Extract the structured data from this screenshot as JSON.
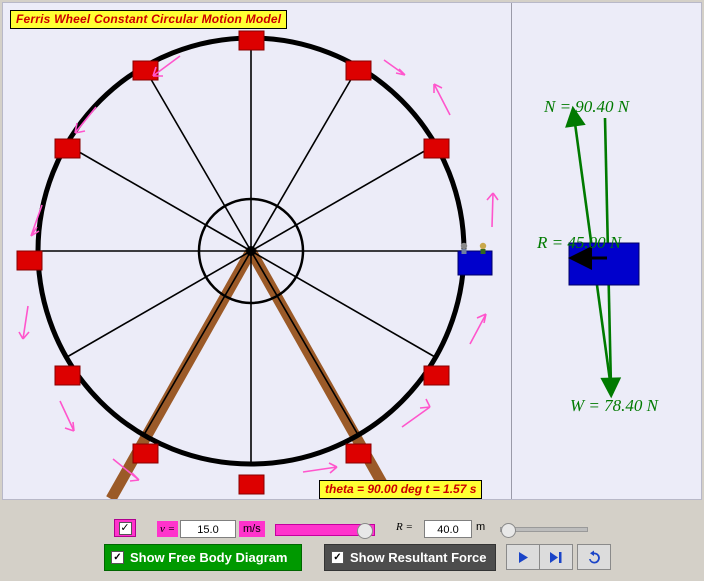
{
  "window": {
    "title": "Ferris Wheel Constant Circular Motion Model"
  },
  "simulation": {
    "title_label": "Ferris Wheel Constant Circular Motion Model",
    "readout": "theta = 90.00 deg t = 1.57 s",
    "theta_deg": 90.0,
    "time_s": 1.57,
    "cab_passenger_count": 2,
    "spoke_cab_count": 12,
    "velocity_arrow_color": "#ff55cc",
    "wheel_rim_color": "#000000",
    "cab_color": "#cc0000",
    "rider_cab_color": "#0000cc",
    "support_color": "#9b5a28"
  },
  "free_body_diagram": {
    "normal_label": "N = 90.40 N",
    "resultant_label": "R = 45.00 N",
    "weight_label": "W = 78.40 N",
    "normal_value": 90.4,
    "resultant_value": 45.0,
    "weight_value": 78.4,
    "vector_color": "#007a00",
    "body_color": "#0000cc"
  },
  "controls": {
    "animate_checkbox": {
      "name": "play-toggle",
      "checked": true,
      "mark": "✓"
    },
    "velocity": {
      "label": "v =",
      "value": "15.0",
      "unit": "m/s",
      "slider_percent": 92
    },
    "radius": {
      "label": "R =",
      "value": "40.0",
      "unit": "m",
      "slider_percent": 4
    },
    "show_fbd": {
      "label": "Show Free Body Diagram",
      "checked": true,
      "mark": "✓"
    },
    "show_resultant": {
      "label": "Show Resultant Force",
      "checked": true,
      "mark": "✓"
    },
    "buttons": [
      {
        "name": "play-button",
        "glyph": "▶"
      },
      {
        "name": "step-button",
        "glyph": "▶❙"
      },
      {
        "name": "reset-button",
        "glyph": "↺"
      }
    ]
  }
}
